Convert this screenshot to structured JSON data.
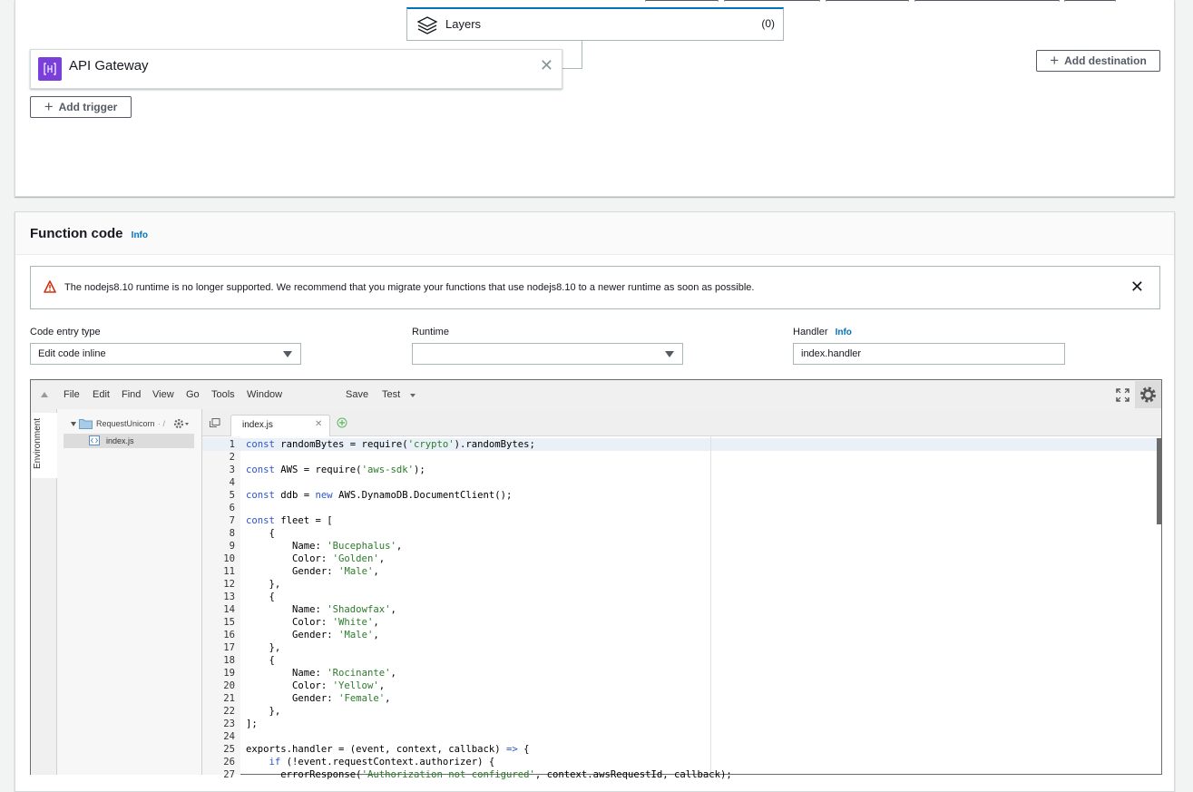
{
  "designer": {
    "layers_label": "Layers",
    "layers_count": "(0)",
    "trigger_label": "API Gateway",
    "add_trigger": "Add trigger",
    "add_destination": "Add destination"
  },
  "function_code": {
    "title": "Function code",
    "info": "Info",
    "alert": "The nodejs8.10 runtime is no longer supported. We recommend that you migrate your functions that use nodejs8.10 to a newer runtime as soon as possible.",
    "code_entry_label": "Code entry type",
    "code_entry_value": "Edit code inline",
    "runtime_label": "Runtime",
    "runtime_value": "",
    "handler_label": "Handler",
    "handler_info": "Info",
    "handler_value": "index.handler"
  },
  "ide": {
    "menu": [
      "File",
      "Edit",
      "Find",
      "View",
      "Go",
      "Tools",
      "Window"
    ],
    "save": "Save",
    "test": "Test",
    "env_label": "Environment",
    "folder": "RequestUnicorn",
    "file": "index.js",
    "tab": "index.js",
    "code": [
      [
        {
          "t": "const",
          "c": "k"
        },
        {
          "t": " randomBytes = require("
        },
        {
          "t": "'crypto'",
          "c": "s"
        },
        {
          "t": ").randomBytes;"
        }
      ],
      [],
      [
        {
          "t": "const",
          "c": "k"
        },
        {
          "t": " AWS = require("
        },
        {
          "t": "'aws-sdk'",
          "c": "s"
        },
        {
          "t": ");"
        }
      ],
      [],
      [
        {
          "t": "const",
          "c": "k"
        },
        {
          "t": " ddb = "
        },
        {
          "t": "new",
          "c": "k"
        },
        {
          "t": " AWS.DynamoDB.DocumentClient();"
        }
      ],
      [],
      [
        {
          "t": "const",
          "c": "k"
        },
        {
          "t": " fleet = ["
        }
      ],
      [
        {
          "t": "    {"
        }
      ],
      [
        {
          "t": "        Name: "
        },
        {
          "t": "'Bucephalus'",
          "c": "s"
        },
        {
          "t": ","
        }
      ],
      [
        {
          "t": "        Color: "
        },
        {
          "t": "'Golden'",
          "c": "s"
        },
        {
          "t": ","
        }
      ],
      [
        {
          "t": "        Gender: "
        },
        {
          "t": "'Male'",
          "c": "s"
        },
        {
          "t": ","
        }
      ],
      [
        {
          "t": "    },"
        }
      ],
      [
        {
          "t": "    {"
        }
      ],
      [
        {
          "t": "        Name: "
        },
        {
          "t": "'Shadowfax'",
          "c": "s"
        },
        {
          "t": ","
        }
      ],
      [
        {
          "t": "        Color: "
        },
        {
          "t": "'White'",
          "c": "s"
        },
        {
          "t": ","
        }
      ],
      [
        {
          "t": "        Gender: "
        },
        {
          "t": "'Male'",
          "c": "s"
        },
        {
          "t": ","
        }
      ],
      [
        {
          "t": "    },"
        }
      ],
      [
        {
          "t": "    {"
        }
      ],
      [
        {
          "t": "        Name: "
        },
        {
          "t": "'Rocinante'",
          "c": "s"
        },
        {
          "t": ","
        }
      ],
      [
        {
          "t": "        Color: "
        },
        {
          "t": "'Yellow'",
          "c": "s"
        },
        {
          "t": ","
        }
      ],
      [
        {
          "t": "        Gender: "
        },
        {
          "t": "'Female'",
          "c": "s"
        },
        {
          "t": ","
        }
      ],
      [
        {
          "t": "    },"
        }
      ],
      [
        {
          "t": "];"
        }
      ],
      [],
      [
        {
          "t": "exports.handler = (event, context, callback) "
        },
        {
          "t": "=>",
          "c": "k"
        },
        {
          "t": " {"
        }
      ],
      [
        {
          "t": "    "
        },
        {
          "t": "if",
          "c": "k"
        },
        {
          "t": " (!event.requestContext.authorizer) {"
        }
      ],
      [
        {
          "t": "      errorResponse("
        },
        {
          "t": "'Authorization not configured'",
          "c": "s"
        },
        {
          "t": ", context.awsRequestId, callback);"
        }
      ]
    ]
  }
}
